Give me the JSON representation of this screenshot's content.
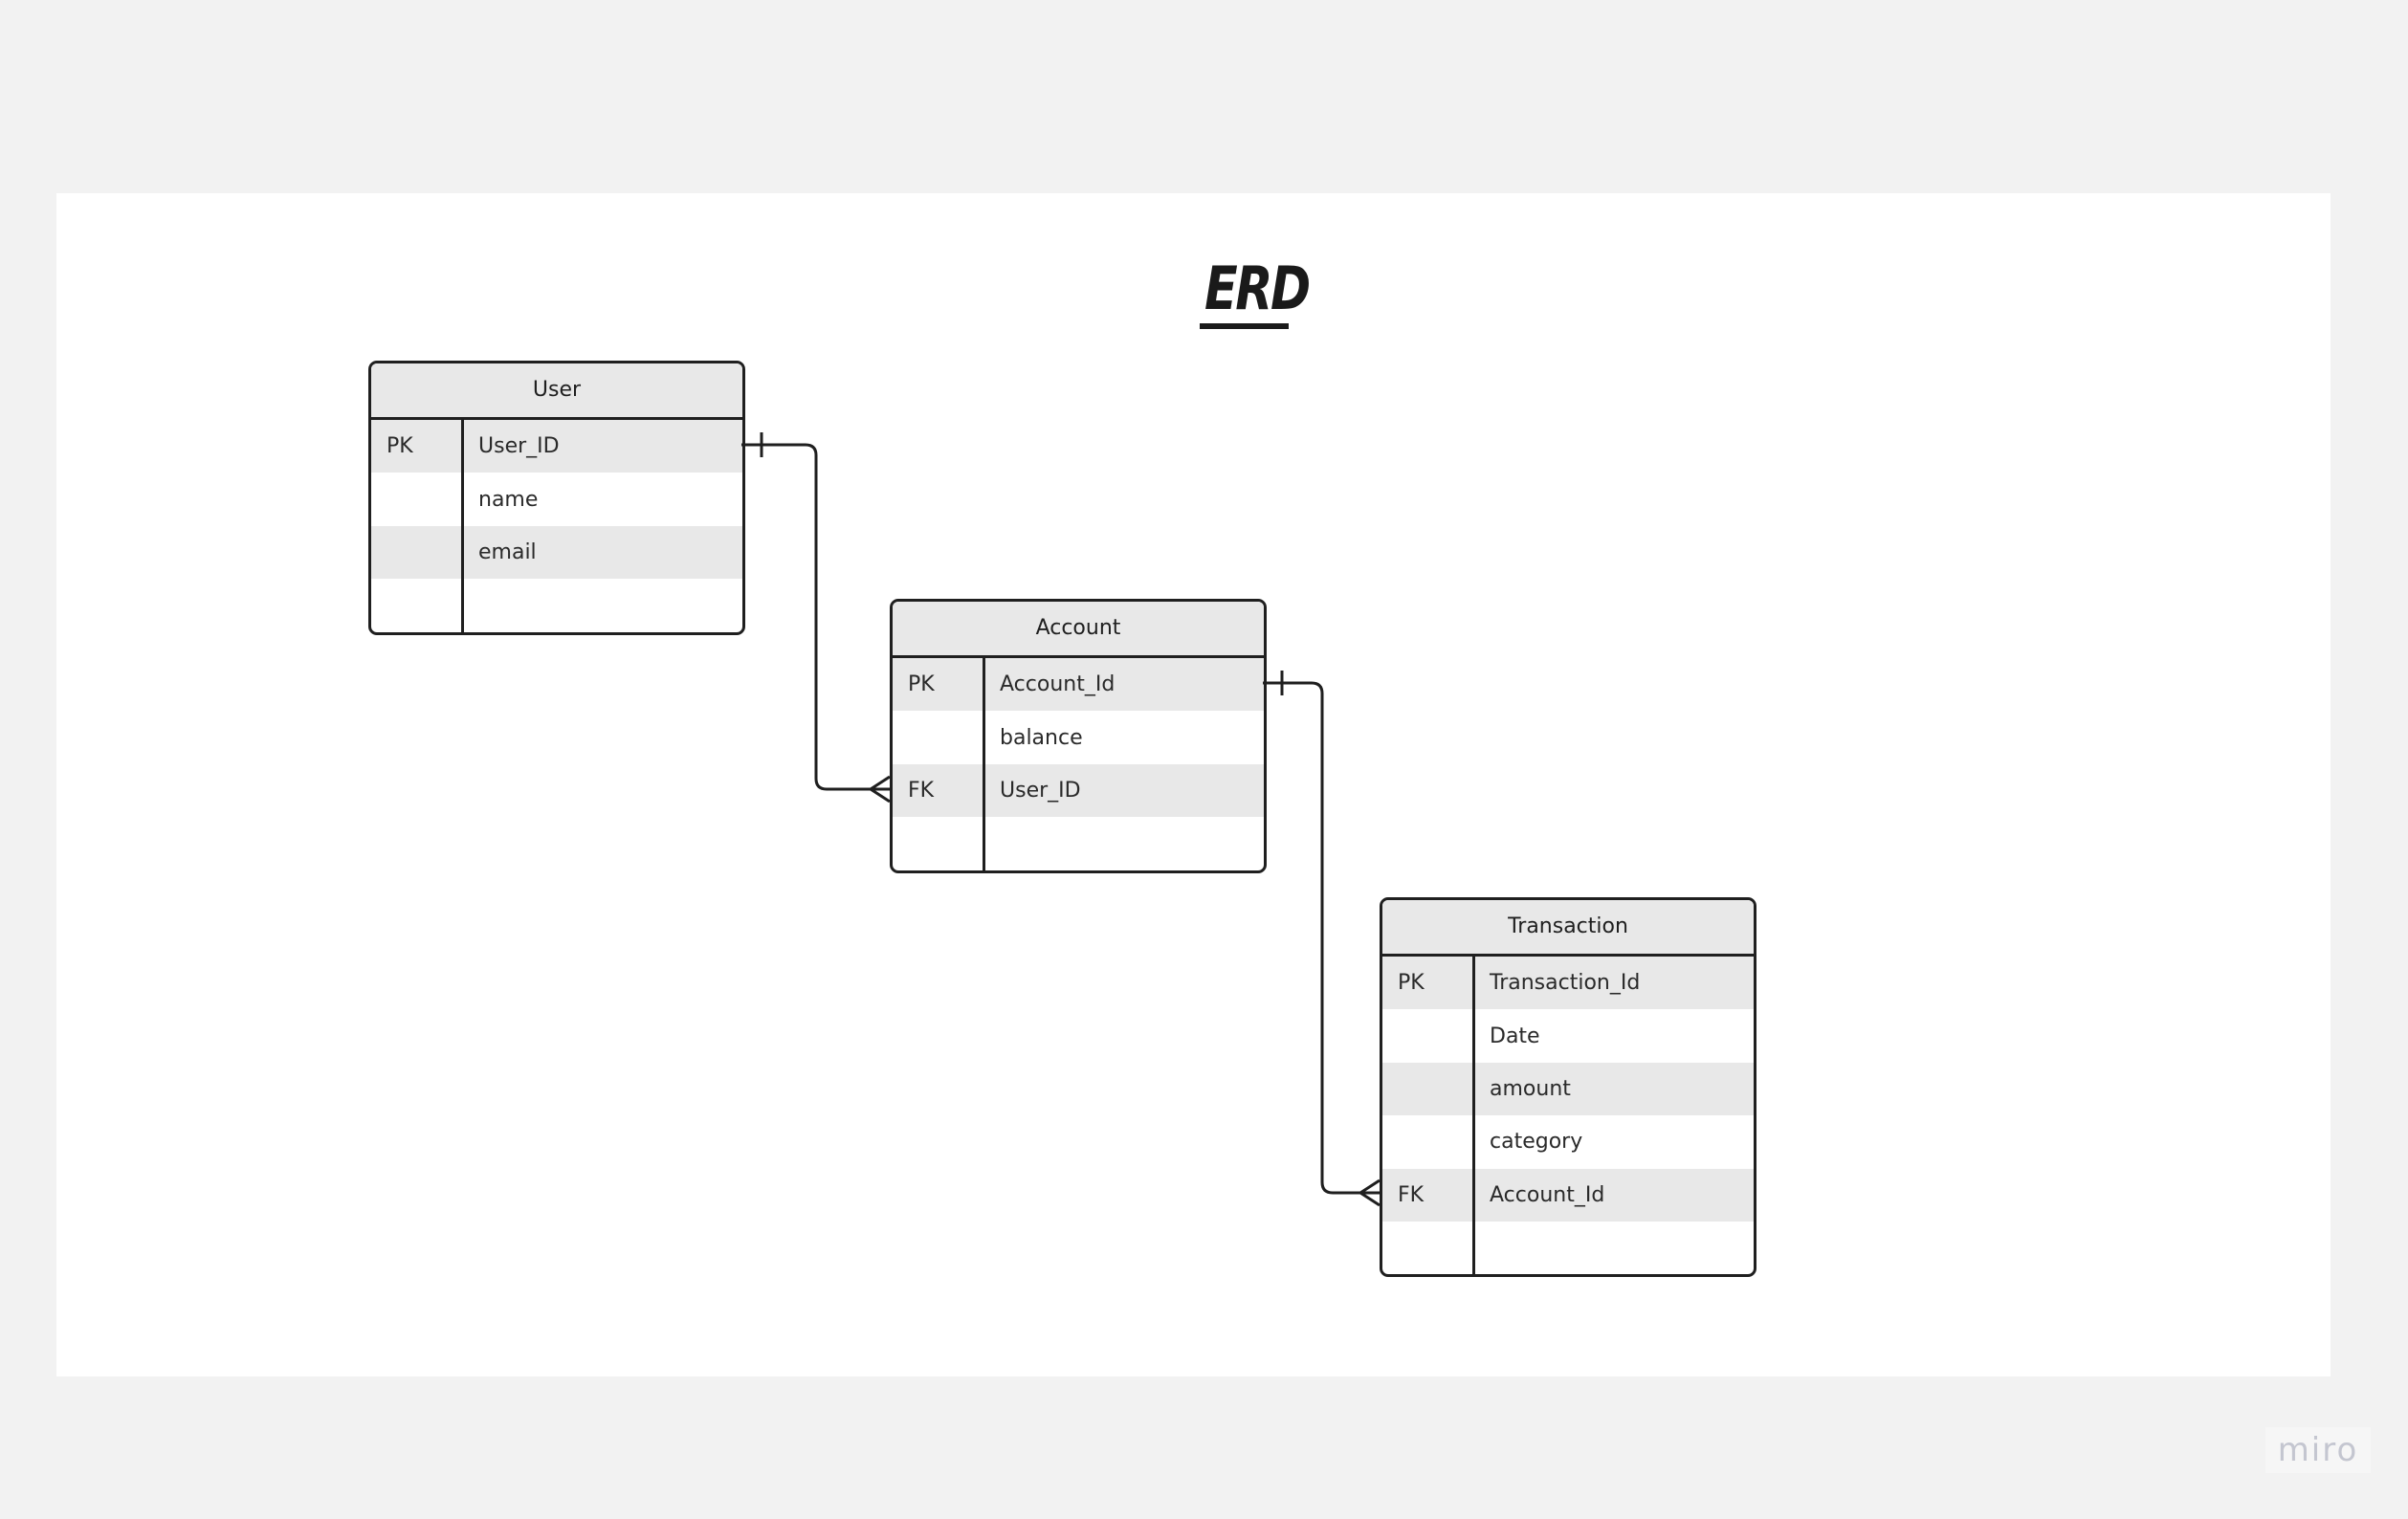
{
  "diagram": {
    "title": "ERD",
    "entities": [
      {
        "name": "User",
        "rows": [
          {
            "key": "PK",
            "attr": "User_ID"
          },
          {
            "key": "",
            "attr": "name"
          },
          {
            "key": "",
            "attr": "email"
          },
          {
            "key": "",
            "attr": ""
          }
        ]
      },
      {
        "name": "Account",
        "rows": [
          {
            "key": "PK",
            "attr": "Account_Id"
          },
          {
            "key": "",
            "attr": "balance"
          },
          {
            "key": "FK",
            "attr": "User_ID"
          },
          {
            "key": "",
            "attr": ""
          }
        ]
      },
      {
        "name": "Transaction",
        "rows": [
          {
            "key": "PK",
            "attr": "Transaction_Id"
          },
          {
            "key": "",
            "attr": "Date"
          },
          {
            "key": "",
            "attr": "amount"
          },
          {
            "key": "",
            "attr": "category"
          },
          {
            "key": "FK",
            "attr": "Account_Id"
          },
          {
            "key": "",
            "attr": ""
          }
        ]
      }
    ],
    "relationships": [
      {
        "from": "User.User_ID",
        "to": "Account.User_ID",
        "from_cardinality": "one",
        "to_cardinality": "many"
      },
      {
        "from": "Account.Account_Id",
        "to": "Transaction.Account_Id",
        "from_cardinality": "one",
        "to_cardinality": "many"
      }
    ]
  },
  "branding": {
    "logo_text": "miro"
  }
}
